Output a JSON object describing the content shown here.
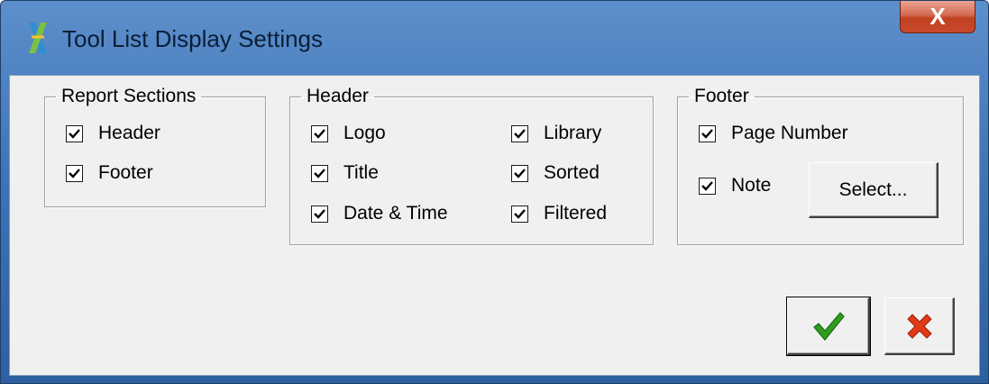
{
  "window": {
    "title": "Tool List Display Settings",
    "close_label": "X"
  },
  "report_sections": {
    "legend": "Report Sections",
    "items": [
      {
        "label": "Header",
        "checked": true
      },
      {
        "label": "Footer",
        "checked": true
      }
    ]
  },
  "header_group": {
    "legend": "Header",
    "items": [
      {
        "label": "Logo",
        "checked": true
      },
      {
        "label": "Title",
        "checked": true
      },
      {
        "label": "Date & Time",
        "checked": true
      },
      {
        "label": "Library",
        "checked": true
      },
      {
        "label": "Sorted",
        "checked": true
      },
      {
        "label": "Filtered",
        "checked": true
      }
    ]
  },
  "footer_group": {
    "legend": "Footer",
    "items": [
      {
        "label": "Page Number",
        "checked": true
      },
      {
        "label": "Note",
        "checked": true
      }
    ],
    "select_button": "Select..."
  },
  "buttons": {
    "ok_icon": "green-checkmark-icon",
    "cancel_icon": "red-x-icon"
  },
  "colors": {
    "ok_green": "#2f9e1f",
    "cancel_red": "#e23a16",
    "titlebar_blue": "#4a7fc1"
  }
}
